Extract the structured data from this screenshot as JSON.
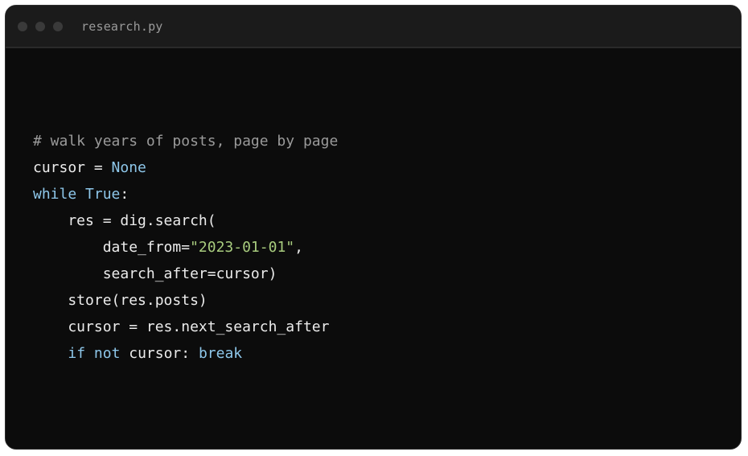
{
  "window": {
    "filename": "research.py"
  },
  "code": {
    "lines": [
      [
        {
          "t": "cm",
          "v": "# walk years of posts, page by page"
        }
      ],
      [
        {
          "t": "tx",
          "v": "cursor = "
        },
        {
          "t": "kw",
          "v": "None"
        }
      ],
      [
        {
          "t": "kw",
          "v": "while"
        },
        {
          "t": "tx",
          "v": " "
        },
        {
          "t": "kw",
          "v": "True"
        },
        {
          "t": "tx",
          "v": ":"
        }
      ],
      [
        {
          "t": "tx",
          "v": "    res = dig.search("
        }
      ],
      [
        {
          "t": "tx",
          "v": "        date_from="
        },
        {
          "t": "st",
          "v": "\"2023-01-01\""
        },
        {
          "t": "tx",
          "v": ","
        }
      ],
      [
        {
          "t": "tx",
          "v": "        search_after=cursor)"
        }
      ],
      [
        {
          "t": "tx",
          "v": "    store(res.posts)"
        }
      ],
      [
        {
          "t": "tx",
          "v": "    cursor = res.next_search_after"
        }
      ],
      [
        {
          "t": "tx",
          "v": "    "
        },
        {
          "t": "kw",
          "v": "if"
        },
        {
          "t": "tx",
          "v": " "
        },
        {
          "t": "kw",
          "v": "not"
        },
        {
          "t": "tx",
          "v": " cursor: "
        },
        {
          "t": "kw",
          "v": "break"
        }
      ]
    ]
  },
  "colors": {
    "background": "#0c0c0c",
    "titlebar": "#1b1b1b",
    "comment": "#9a9a9a",
    "keyword": "#8ec7ea",
    "string": "#a8cc7e",
    "text": "#ececec"
  }
}
